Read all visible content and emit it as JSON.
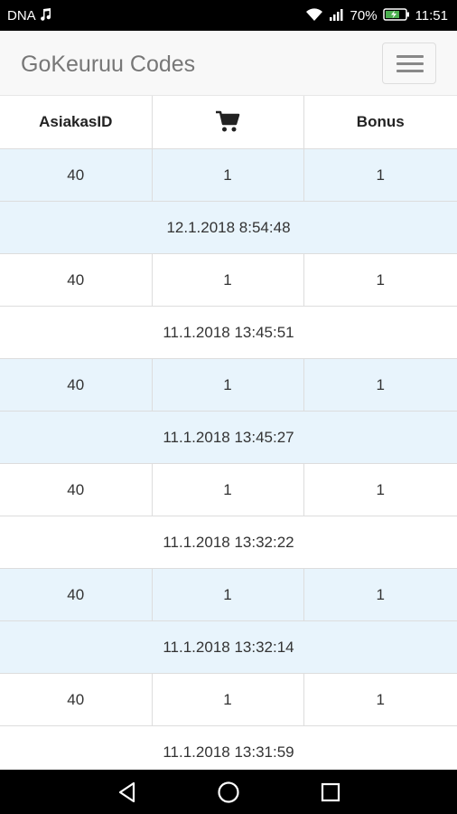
{
  "status_bar": {
    "carrier": "DNA",
    "battery": "70%",
    "time": "11:51",
    "icons": [
      "music-note-icon",
      "wifi-icon",
      "signal-icon",
      "battery-charging-icon"
    ]
  },
  "navbar": {
    "brand": "GoKeuruu Codes",
    "menu_icon": "hamburger-menu-icon"
  },
  "table": {
    "headers": [
      "AsiakasID",
      "cart-icon",
      "Bonus"
    ],
    "rows": [
      {
        "id": "40",
        "qty": "1",
        "bonus": "1",
        "date": "12.1.2018 8:54:48"
      },
      {
        "id": "40",
        "qty": "1",
        "bonus": "1",
        "date": "11.1.2018 13:45:51"
      },
      {
        "id": "40",
        "qty": "1",
        "bonus": "1",
        "date": "11.1.2018 13:45:27"
      },
      {
        "id": "40",
        "qty": "1",
        "bonus": "1",
        "date": "11.1.2018 13:32:22"
      },
      {
        "id": "40",
        "qty": "1",
        "bonus": "1",
        "date": "11.1.2018 13:32:14"
      },
      {
        "id": "40",
        "qty": "1",
        "bonus": "1",
        "date": "11.1.2018 13:31:59"
      }
    ]
  },
  "colors": {
    "row_highlight": "#e8f4fc",
    "navbar_bg": "#f8f8f8",
    "brand_text": "#777777"
  },
  "system_nav": [
    "back-icon",
    "home-icon",
    "recents-icon"
  ]
}
